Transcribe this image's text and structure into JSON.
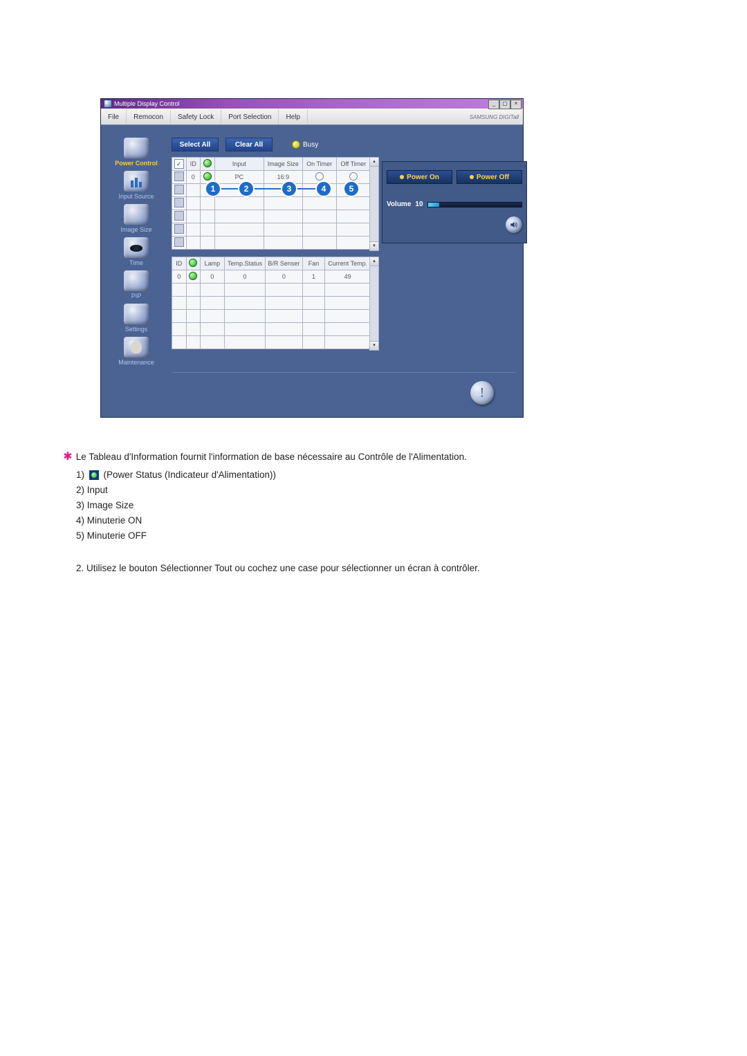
{
  "window": {
    "title": "Multiple Display Control",
    "brand": "SAMSUNG DIGITall"
  },
  "menu": {
    "file": "File",
    "remocon": "Remocon",
    "safety_lock": "Safety Lock",
    "port_selection": "Port Selection",
    "help": "Help"
  },
  "sidebar": {
    "items": [
      {
        "label": "Power Control"
      },
      {
        "label": "Input Source"
      },
      {
        "label": "Image Size"
      },
      {
        "label": "Time"
      },
      {
        "label": "PIP"
      },
      {
        "label": "Settings"
      },
      {
        "label": "Maintenance"
      }
    ],
    "active_index": 0
  },
  "toolbar": {
    "select_all": "Select All",
    "clear_all": "Clear All",
    "busy_label": "Busy"
  },
  "grid1": {
    "headers": {
      "checkbox": "",
      "id": "ID",
      "status": "",
      "input": "Input",
      "image_size": "Image Size",
      "on_timer": "On Timer",
      "off_timer": "Off Timer"
    },
    "rows": [
      {
        "checked": true,
        "id": "0",
        "status": "on",
        "input": "PC",
        "image_size": "16:9",
        "on_timer": "○",
        "off_timer": "○"
      },
      {
        "checked": false,
        "id": "",
        "status": "",
        "input": "",
        "image_size": "",
        "on_timer": "",
        "off_timer": ""
      },
      {
        "checked": false,
        "id": "",
        "status": "",
        "input": "",
        "image_size": "",
        "on_timer": "",
        "off_timer": ""
      },
      {
        "checked": false,
        "id": "",
        "status": "",
        "input": "",
        "image_size": "",
        "on_timer": "",
        "off_timer": ""
      },
      {
        "checked": false,
        "id": "",
        "status": "",
        "input": "",
        "image_size": "",
        "on_timer": "",
        "off_timer": ""
      },
      {
        "checked": false,
        "id": "",
        "status": "",
        "input": "",
        "image_size": "",
        "on_timer": "",
        "off_timer": ""
      }
    ]
  },
  "grid2": {
    "headers": {
      "id": "ID",
      "status": "",
      "lamp": "Lamp",
      "temp_status": "Temp.Status",
      "br_sensor": "B/R Senser",
      "fan": "Fan",
      "current_temp": "Current Temp."
    },
    "rows": [
      {
        "id": "0",
        "status": "on",
        "lamp": "0",
        "temp_status": "0",
        "br_sensor": "0",
        "fan": "1",
        "current_temp": "49"
      },
      {
        "id": "",
        "status": "",
        "lamp": "",
        "temp_status": "",
        "br_sensor": "",
        "fan": "",
        "current_temp": ""
      },
      {
        "id": "",
        "status": "",
        "lamp": "",
        "temp_status": "",
        "br_sensor": "",
        "fan": "",
        "current_temp": ""
      },
      {
        "id": "",
        "status": "",
        "lamp": "",
        "temp_status": "",
        "br_sensor": "",
        "fan": "",
        "current_temp": ""
      },
      {
        "id": "",
        "status": "",
        "lamp": "",
        "temp_status": "",
        "br_sensor": "",
        "fan": "",
        "current_temp": ""
      },
      {
        "id": "",
        "status": "",
        "lamp": "",
        "temp_status": "",
        "br_sensor": "",
        "fan": "",
        "current_temp": ""
      }
    ]
  },
  "callouts": {
    "m1": "1",
    "m2": "2",
    "m3": "3",
    "m4": "4",
    "m5": "5"
  },
  "right": {
    "power_on": "Power On",
    "power_off": "Power Off",
    "volume_label": "Volume",
    "volume_value": "10",
    "volume_percent": 12
  },
  "doc": {
    "intro": "Le Tableau d'Information fournit l'information de base nécessaire au Contrôle de l'Alimentation.",
    "l1_prefix": "1) ",
    "l1_suffix": " (Power Status (Indicateur d'Alimentation))",
    "l2": "2) Input",
    "l3": "3) Image Size",
    "l4": "4) Minuterie ON",
    "l5": "5) Minuterie OFF",
    "p2": "2.   Utilisez le bouton Sélectionner Tout ou cochez une case pour sélectionner un écran à contrôler."
  }
}
